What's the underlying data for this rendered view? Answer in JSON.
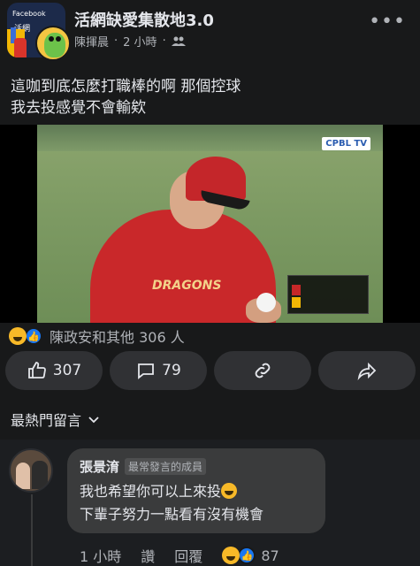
{
  "header": {
    "group_name": "活網缺愛集散地3.0",
    "author": "陳揮晨",
    "time": "2 小時",
    "dot": "·",
    "audience_icon": "group-icon",
    "more_icon": "more-icon",
    "avatar_caption": "Facebook"
  },
  "post": {
    "text_line1": "這咖到底怎麼打職棒的啊 那個控球",
    "text_line2": "我去投感覺不會輸欸",
    "media": {
      "broadcast_logo": "CPBL TV",
      "jersey_text": "DRAGONS"
    }
  },
  "reactions": {
    "summary": "陳政安和其他 306 人",
    "icons": [
      "haha-reaction-icon",
      "like-reaction-icon"
    ]
  },
  "actions": {
    "like_count": "307",
    "comment_count": "79",
    "link_icon": "link-icon",
    "share_icon": "share-icon"
  },
  "comments_section": {
    "label": "最熱門留言"
  },
  "comments": [
    {
      "name": "張景淯",
      "badge": "最常發言的成員",
      "line1": "我也希望你可以上來投",
      "line2": "下輩子努力一點看有沒有機會",
      "time": "1 小時",
      "like_label": "讚",
      "reply_label": "回覆",
      "reaction_count": "87"
    }
  ],
  "colors": {
    "background": "#18191a",
    "button_bg": "#303134",
    "bubble_bg": "#3a3b3c",
    "text_primary": "#e4e6eb",
    "text_secondary": "#b0b3b8",
    "like_blue": "#1877f2",
    "haha_yellow": "#f7b928"
  }
}
